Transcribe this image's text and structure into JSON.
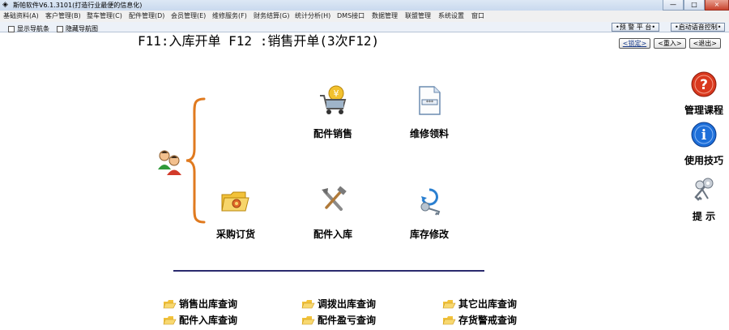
{
  "window": {
    "title": "斯帕软件V6.1.3101(打造行业最便的信息化)",
    "buttons": {
      "minimize": "—",
      "maximize": "□",
      "close": "×"
    }
  },
  "menu": [
    "基础资料(A)",
    "客户管理(B)",
    "整车管理(C)",
    "配件管理(D)",
    "会员管理(E)",
    "维修服务(F)",
    "财务结算(G)",
    "统计分析(H)",
    "DMS接口",
    "数据管理",
    "联盟管理",
    "系统设置",
    "窗口"
  ],
  "toolbar": {
    "show_nav_bar": "显示导航条",
    "hide_nav_map": "隐藏导航图",
    "warning_platform": "•预 警 平 台•",
    "voice_control": "•启动语音控制•"
  },
  "hotkeys": {
    "text": "F11:入库开单  F12 :销售开单(3次F12)"
  },
  "actions": {
    "lock": "锁定",
    "reenter": "重入",
    "exit": "退出"
  },
  "tiles": {
    "parts_sales": "配件销售",
    "repair_pick": "维修领料",
    "purchase_order": "采购订货",
    "parts_inbound": "配件入库",
    "stock_modify": "库存修改"
  },
  "queries": {
    "sales_out": "销售出库查询",
    "transfer_out": "调拨出库查询",
    "other_out": "其它出库查询",
    "parts_in": "配件入库查询",
    "parts_gainloss": "配件盈亏查询",
    "stock_alert": "存货警戒查询"
  },
  "side": {
    "course": "管理课程",
    "tips": "使用技巧",
    "hint": "提  示"
  },
  "colors": {
    "accent_orange": "#e07a1f",
    "divider": "#2a2a6e",
    "help_red": "#d9381e",
    "info_blue": "#1e6fd9"
  }
}
